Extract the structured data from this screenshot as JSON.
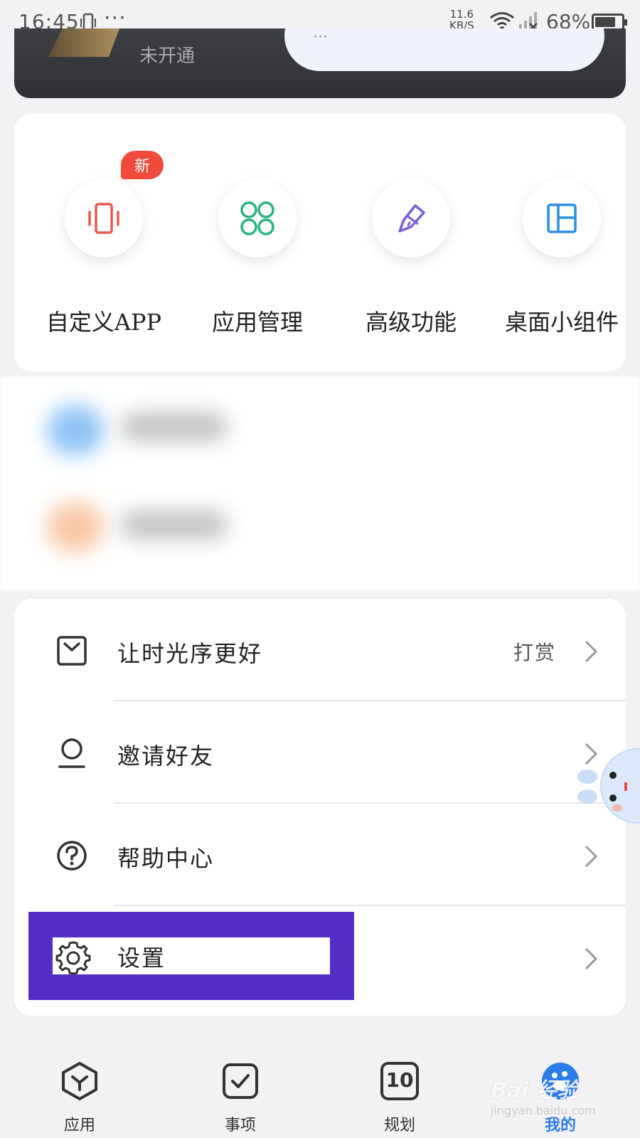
{
  "status_bar": {
    "time": "16:45",
    "dots": "···",
    "net_speed_value": "11.6",
    "net_speed_unit": "KB/S",
    "battery_percent": "68%"
  },
  "vip_banner": {
    "status": "未开通",
    "pill_text": "···"
  },
  "features": [
    {
      "label": "自定义APP",
      "icon": "phone-vibrate-icon",
      "badge": "新",
      "color": "#e8584c"
    },
    {
      "label": "应用管理",
      "icon": "four-circles-icon",
      "color": "#27b37e"
    },
    {
      "label": "高级功能",
      "icon": "pen-nib-icon",
      "color": "#7b5fd6"
    },
    {
      "label": "桌面小组件",
      "icon": "widget-layout-icon",
      "color": "#2b8fe0"
    }
  ],
  "menu": [
    {
      "label": "让时光序更好",
      "extra": "打赏",
      "icon": "reward-bag-icon"
    },
    {
      "label": "邀请好友",
      "icon": "person-icon"
    },
    {
      "label": "帮助中心",
      "icon": "help-circle-icon"
    },
    {
      "label": "设置",
      "icon": "gear-icon"
    }
  ],
  "bottom_nav": [
    {
      "label": "应用",
      "icon": "apps-hex-icon"
    },
    {
      "label": "事项",
      "icon": "checkbox-icon"
    },
    {
      "label": "规划",
      "icon": "calendar-10-icon",
      "date": "10"
    },
    {
      "label": "我的",
      "icon": "profile-paw-icon",
      "active": true
    }
  ],
  "watermark": {
    "brand": "Bai 经验",
    "url": "jingyan.baidu.com"
  },
  "colors": {
    "highlight": "#552ec6",
    "active_nav": "#2b7de8",
    "badge": "#f04a3a"
  }
}
